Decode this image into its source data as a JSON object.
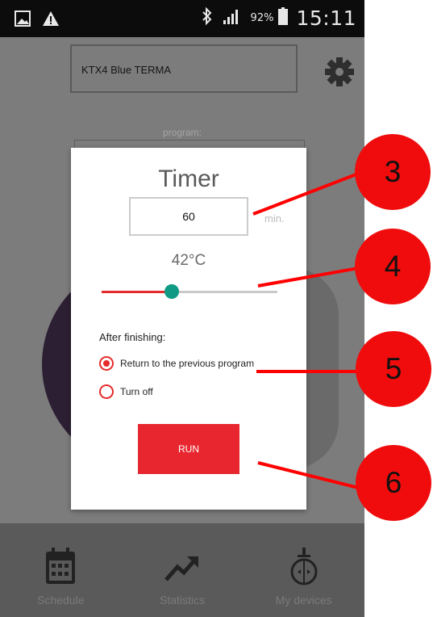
{
  "status_bar": {
    "battery_percent": "92%",
    "time": "15:11"
  },
  "header": {
    "device_name": "KTX4 Blue TERMA"
  },
  "program": {
    "label": "program:"
  },
  "dialog": {
    "title": "Timer",
    "timer_value": "60",
    "unit": "min.",
    "temperature": "42°C",
    "slider_level_percent": 40,
    "after_finishing_label": "After finishing:",
    "options": [
      {
        "label": "Return to the previous program",
        "selected": true
      },
      {
        "label": "Turn off",
        "selected": false
      }
    ],
    "run_label": "RUN"
  },
  "nav": {
    "items": [
      {
        "label": "Schedule",
        "icon": "calendar-icon"
      },
      {
        "label": "Statistics",
        "icon": "trend-icon"
      },
      {
        "label": "My devices",
        "icon": "device-icon"
      }
    ]
  },
  "callouts": [
    "3",
    "4",
    "5",
    "6"
  ],
  "colors": {
    "accent": "#e8262f",
    "slider_thumb": "#0e9a84",
    "callout": "#f00c0c"
  }
}
